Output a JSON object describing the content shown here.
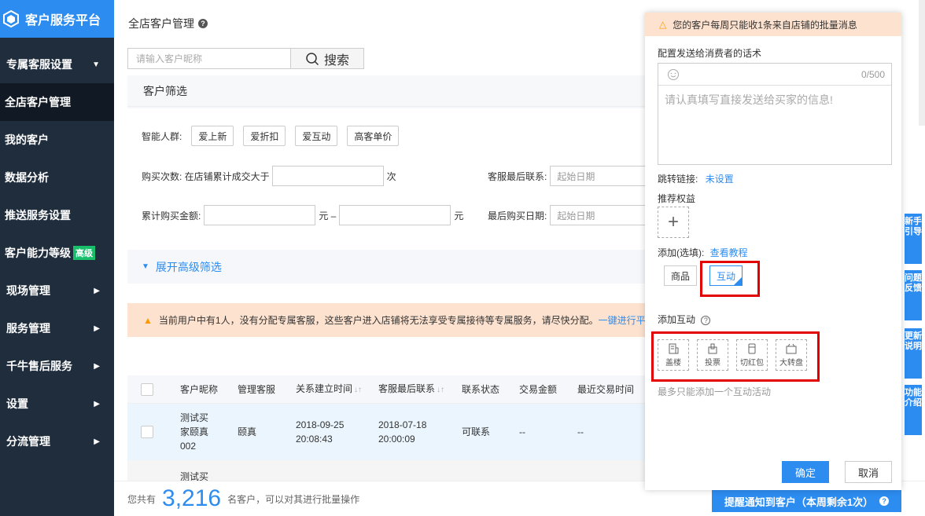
{
  "app": {
    "title": "客户服务平台"
  },
  "sidebar": {
    "items": [
      {
        "label": "专属客服设置",
        "arrow": "▼"
      },
      {
        "label": "全店客户管理"
      },
      {
        "label": "我的客户"
      },
      {
        "label": "数据分析"
      },
      {
        "label": "推送服务设置"
      },
      {
        "label": "客户能力等级",
        "badge": "高级"
      },
      {
        "label": "现场管理",
        "arrow": "▶"
      },
      {
        "label": "服务管理",
        "arrow": "▶"
      },
      {
        "label": "千牛售后服务",
        "arrow": "▶"
      },
      {
        "label": "设置",
        "arrow": "▶"
      },
      {
        "label": "分流管理",
        "arrow": "▶"
      }
    ]
  },
  "header": {
    "title": "全店客户管理",
    "help": "?"
  },
  "search": {
    "placeholder": "请输入客户昵称",
    "button": "搜索"
  },
  "filter": {
    "title": "客户筛选",
    "crowd_label": "智能人群:",
    "crowd_tags": [
      "爱上新",
      "爱折扣",
      "爱互动",
      "高客单价"
    ],
    "purchase_label": "购买次数: 在店铺累计成交大于",
    "purchase_unit": "次",
    "last_contact_label": "客服最后联系:",
    "amount_label": "累计购买金额:",
    "amount_unit1": "元 –",
    "amount_unit2": "元",
    "last_buy_label": "最后购买日期:",
    "date_placeholder": "起始日期",
    "expand": "展开高级筛选"
  },
  "notice": {
    "text": "当前用户中有1人，没有分配专属客服，这些客户进入店铺将无法享受专属接待等专属服务，请尽快分配。",
    "link": "一键进行平"
  },
  "table": {
    "headers": [
      "客户昵称",
      "管理客服",
      "关系建立时间",
      "客服最后联系",
      "联系状态",
      "交易金额",
      "最近交易时间"
    ],
    "rows": [
      {
        "nick": "测试买\n家颐真\n002",
        "agent": "颐真",
        "created": "2018-09-25\n20:08:43",
        "last_contact": "2018-07-18\n20:00:09",
        "status": "可联系",
        "amount": "--",
        "last_trade": "--"
      }
    ],
    "row2_nick": "测试买"
  },
  "footer": {
    "prefix": "您共有",
    "count": "3,216",
    "suffix": "名客户，可以对其进行批量操作",
    "button": "提醒通知到客户（本周剩余1次）"
  },
  "drawer": {
    "warning": "您的客户每周只能收1条来自店铺的批量消息",
    "msg_label": "配置发送给消费者的话术",
    "counter": "0/500",
    "msg_placeholder": "请认真填写直接发送给买家的信息!",
    "jump_label": "跳转链接:",
    "jump_link": "未设置",
    "benefit_label": "推荐权益",
    "add_label": "添加(选填):",
    "tutorial_link": "查看教程",
    "type_goods": "商品",
    "type_interact": "互动",
    "add_interact_label": "添加互动",
    "interact_items": [
      "盖楼",
      "投票",
      "切红包",
      "大转盘"
    ],
    "hint": "最多只能添加一个互动活动",
    "ok": "确定",
    "cancel": "取消"
  },
  "side_tabs": [
    "新手引导",
    "问题反馈",
    "更新说明",
    "功能介绍"
  ],
  "colors": {
    "primary": "#2d8cf0",
    "sidebar": "#1f2d3d",
    "warning_bg": "#fde2cf",
    "highlight": "#e30000",
    "badge": "#19be6b"
  }
}
